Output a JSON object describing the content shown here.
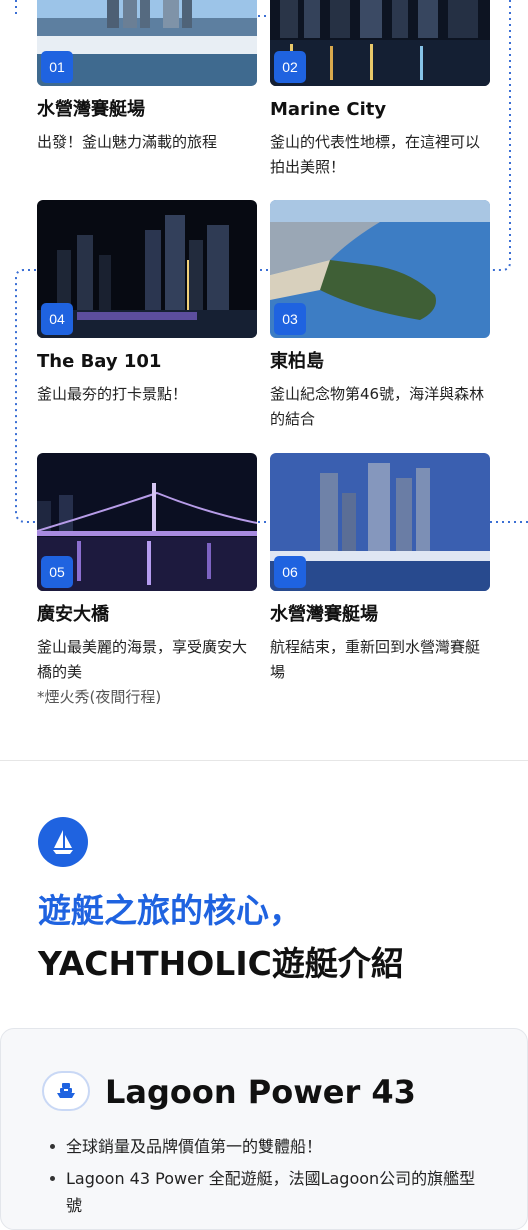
{
  "stops": [
    {
      "number": "01",
      "title": "水營灣賽艇場",
      "description": "出發！釜山魅力滿載的旅程",
      "note": ""
    },
    {
      "number": "02",
      "title": "Marine City",
      "description": "釜山的代表性地標，在這裡可以拍出美照！",
      "note": ""
    },
    {
      "number": "04",
      "title": "The Bay 101",
      "description": "釜山最夯的打卡景點！",
      "note": ""
    },
    {
      "number": "03",
      "title": "東柏島",
      "description": "釜山紀念物第46號，海洋與森林的結合",
      "note": ""
    },
    {
      "number": "05",
      "title": "廣安大橋",
      "description": "釜山最美麗的海景，享受廣安大橋的美",
      "note": "*煙火秀(夜間行程)"
    },
    {
      "number": "06",
      "title": "水營灣賽艇場",
      "description": "航程結束，重新回到水營灣賽艇場",
      "note": ""
    }
  ],
  "section": {
    "icon": "sailboat-icon",
    "heading_line1": "遊艇之旅的核心，",
    "heading_line2": "YACHTHOLIC遊艇介紹"
  },
  "yacht": {
    "icon": "ship-icon",
    "name": "Lagoon Power 43",
    "features": [
      "全球銷量及品牌價值第一的雙體船！",
      "Lagoon 43 Power 全配遊艇，法國Lagoon公司的旗艦型號"
    ]
  },
  "colors": {
    "accent": "#1f63e0",
    "route_line": "#3b6fd4"
  }
}
